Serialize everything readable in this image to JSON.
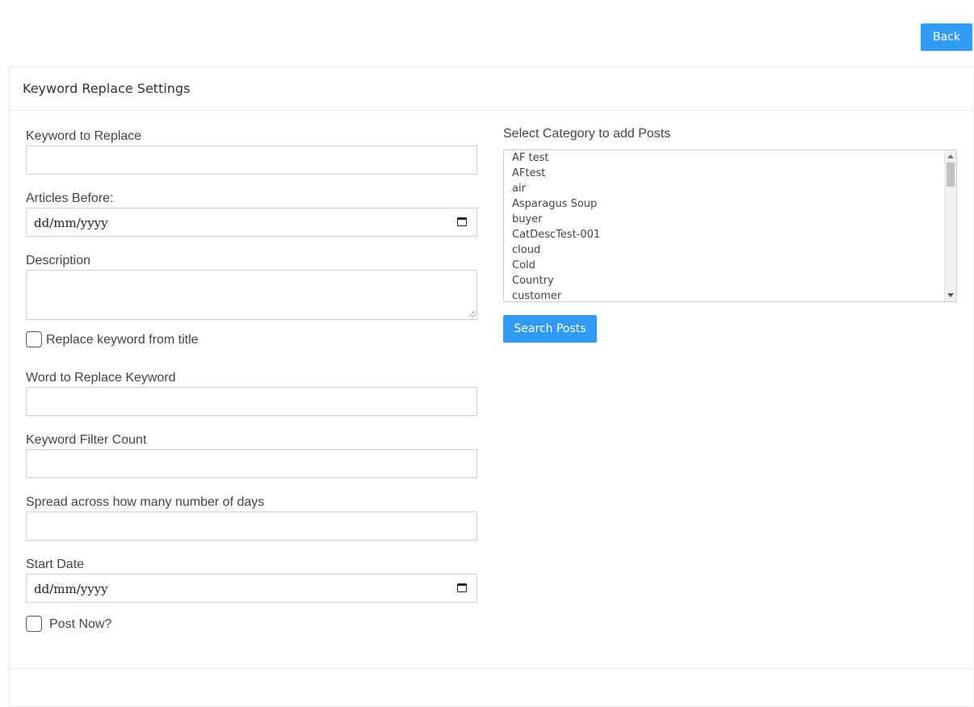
{
  "header": {
    "back_label": "Back"
  },
  "card": {
    "title": "Keyword Replace Settings"
  },
  "form": {
    "keyword_label": "Keyword to Replace",
    "keyword_value": "",
    "articles_before_label": "Articles Before:",
    "articles_before_value": "dd/mm/yyyy",
    "description_label": "Description",
    "description_value": "",
    "replace_title_label": "Replace keyword from title",
    "replace_title_checked": false,
    "word_replace_label": "Word to Replace Keyword",
    "word_replace_value": "",
    "filter_count_label": "Keyword Filter Count",
    "filter_count_value": "",
    "spread_days_label": "Spread across how many number of days",
    "spread_days_value": "",
    "start_date_label": "Start Date",
    "start_date_value": "dd/mm/yyyy",
    "post_now_label": "Post Now?",
    "post_now_checked": false
  },
  "category": {
    "label": "Select Category to add Posts",
    "options": [
      "AF test",
      "AFtest",
      "air",
      "Asparagus Soup",
      "buyer",
      "CatDescTest-001",
      "cloud",
      "Cold",
      "Country",
      "customer"
    ],
    "search_label": "Search Posts"
  },
  "colors": {
    "primary": "#2f9bf5",
    "border": "#cfcfcf"
  }
}
